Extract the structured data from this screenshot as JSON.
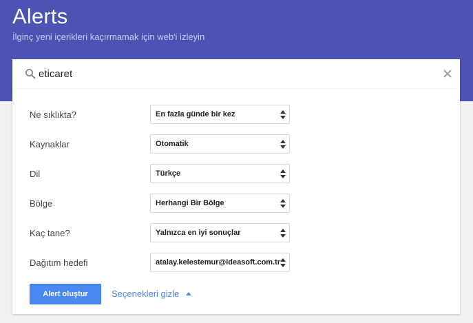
{
  "header": {
    "title": "Alerts",
    "subtitle": "İlginç yeni içerikleri kaçırmamak için web'i izleyin"
  },
  "search": {
    "value": "eticaret",
    "icon": "search-icon",
    "clear_icon": "close-icon"
  },
  "options": [
    {
      "label": "Ne sıklıkta?",
      "value": "En fazla günde bir kez"
    },
    {
      "label": "Kaynaklar",
      "value": "Otomatik"
    },
    {
      "label": "Dil",
      "value": "Türkçe"
    },
    {
      "label": "Bölge",
      "value": "Herhangi Bir Bölge"
    },
    {
      "label": "Kaç tane?",
      "value": "Yalnızca en iyi sonuçlar"
    },
    {
      "label": "Dağıtım hedefi",
      "value": "atalay.kelestemur@ideasoft.com.tr"
    }
  ],
  "actions": {
    "create_label": "Alert oluştur",
    "hide_options_label": "Seçenekleri gizle"
  },
  "colors": {
    "header_bg": "#4b54b3",
    "primary_button": "#4a89f0",
    "link": "#4a86e8"
  }
}
